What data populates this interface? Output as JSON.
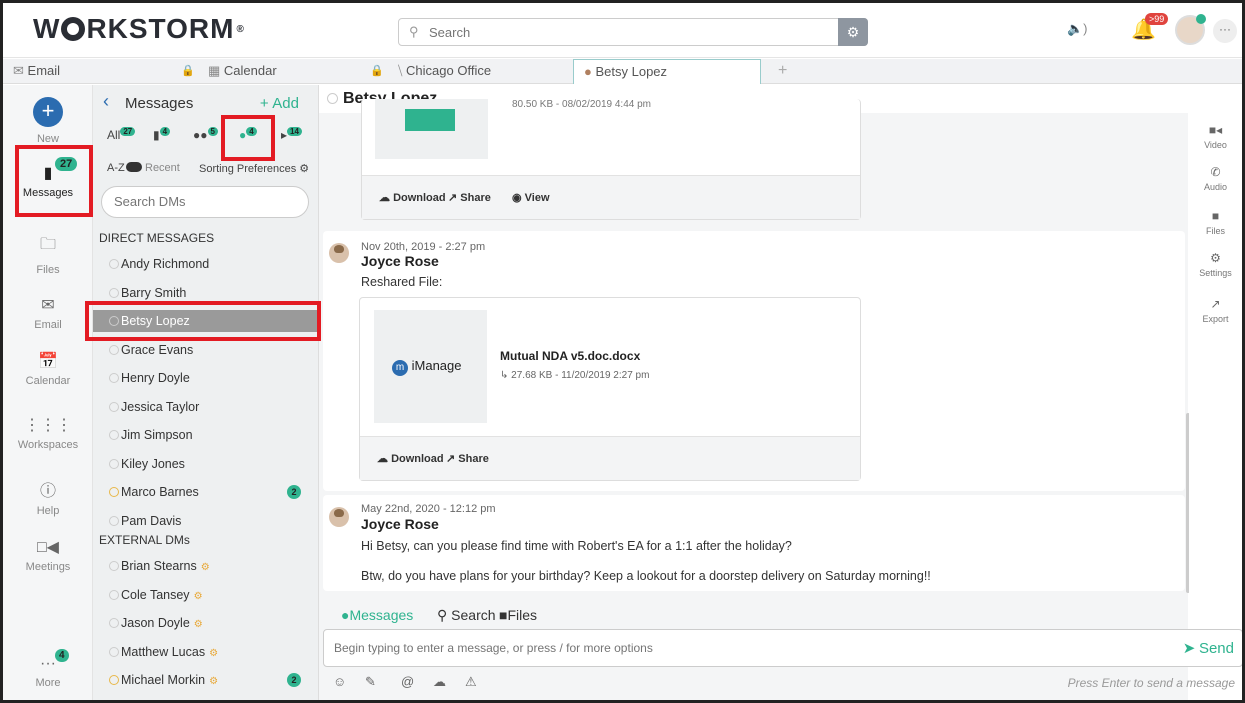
{
  "app": {
    "logo": "W RKSTORM",
    "logo_reg": "®"
  },
  "search": {
    "placeholder": "Search"
  },
  "header": {
    "notifications_badge": ">99"
  },
  "tabs": [
    {
      "label": "Email"
    },
    {
      "label": "Calendar"
    },
    {
      "label": "Chicago Office"
    },
    {
      "label": "Betsy Lopez"
    },
    {
      "label": "+"
    }
  ],
  "rail": {
    "new": "New",
    "messages": "Messages",
    "messages_badge": "27",
    "files": "Files",
    "email": "Email",
    "calendar": "Calendar",
    "workspaces": "Workspaces",
    "help": "Help",
    "meetings": "Meetings",
    "more": "More",
    "more_badge": "4"
  },
  "messages_panel": {
    "title": "Messages",
    "add": "Add",
    "filters": [
      {
        "label": "All",
        "count": "27"
      },
      {
        "label": "",
        "count": "4"
      },
      {
        "label": "",
        "count": "5"
      },
      {
        "label": "",
        "count": "4"
      },
      {
        "label": "",
        "count": "14"
      }
    ],
    "sort_az": "A-Z",
    "sort_recent": "Recent",
    "sorting_prefs": "Sorting Preferences",
    "search_placeholder": "Search DMs",
    "direct_header": "DIRECT MESSAGES",
    "external_header": "EXTERNAL DMs",
    "direct": [
      {
        "name": "Andy Richmond"
      },
      {
        "name": "Barry Smith"
      },
      {
        "name": "Betsy Lopez"
      },
      {
        "name": "Grace Evans"
      },
      {
        "name": "Henry Doyle"
      },
      {
        "name": "Jessica Taylor"
      },
      {
        "name": "Jim Simpson"
      },
      {
        "name": "Kiley Jones"
      },
      {
        "name": "Marco Barnes",
        "count": "2"
      },
      {
        "name": "Pam Davis"
      }
    ],
    "external": [
      {
        "name": "Brian Stearns"
      },
      {
        "name": "Cole Tansey"
      },
      {
        "name": "Jason Doyle"
      },
      {
        "name": "Matthew Lucas"
      },
      {
        "name": "Michael Morkin",
        "count": "2"
      }
    ]
  },
  "conversation": {
    "title": "Betsy Lopez",
    "top_file_meta": "80.50 KB - 08/02/2019 4:44 pm",
    "download": "Download",
    "share": "Share",
    "view": "View",
    "msg1": {
      "date": "Nov 20th, 2019 - 2:27 pm",
      "author": "Joyce Rose",
      "text": "Reshared File:",
      "file_brand": "iManage",
      "file_name": "Mutual NDA v5.doc.docx",
      "file_meta": "27.68 KB - 11/20/2019 2:27 pm"
    },
    "msg2": {
      "date": "May 22nd, 2020 - 12:12 pm",
      "author": "Joyce Rose",
      "line1": "Hi Betsy, can you please find time with Robert's EA for a 1:1 after the holiday?",
      "line2": "Btw, do you have plans for your birthday?  Keep a lookout for a doorstep delivery on Saturday morning!!"
    }
  },
  "right_rail": {
    "video": "Video",
    "audio": "Audio",
    "files": "Files",
    "settings": "Settings",
    "export": "Export"
  },
  "composer": {
    "tab_messages": "Messages",
    "tab_search": "Search",
    "tab_files": "Files",
    "placeholder": "Begin typing to enter a message, or press / for more options",
    "send": "Send",
    "hint": "Press Enter to send a message"
  }
}
